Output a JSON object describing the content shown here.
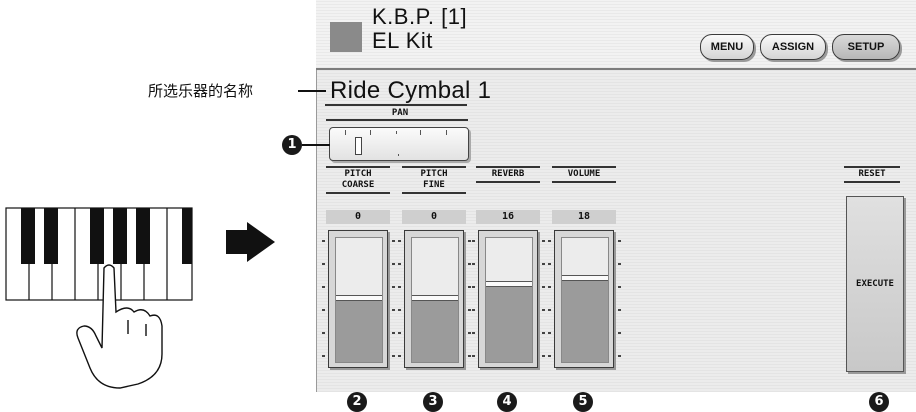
{
  "header": {
    "title_line1": "K.B.P. [1]",
    "title_line2": "EL Kit",
    "buttons": {
      "menu": "MENU",
      "assign": "ASSIGN",
      "setup": "SETUP"
    }
  },
  "instrument": {
    "name": "Ride Cymbal 1",
    "annotation": "所选乐器的名称"
  },
  "pan": {
    "label": "PAN"
  },
  "sliders": [
    {
      "label1": "PITCH",
      "label2": "COARSE",
      "value": "0",
      "level": 0.52,
      "callout": "2"
    },
    {
      "label1": "PITCH",
      "label2": "FINE",
      "value": "0",
      "level": 0.52,
      "callout": "3"
    },
    {
      "label1": "REVERB",
      "label2": "",
      "value": "16",
      "level": 0.63,
      "callout": "4"
    },
    {
      "label1": "VOLUME",
      "label2": "",
      "value": "18",
      "level": 0.68,
      "callout": "5"
    }
  ],
  "reset": {
    "label": "RESET",
    "button": "EXECUTE",
    "callout": "6"
  },
  "callouts": {
    "pan": "1"
  }
}
